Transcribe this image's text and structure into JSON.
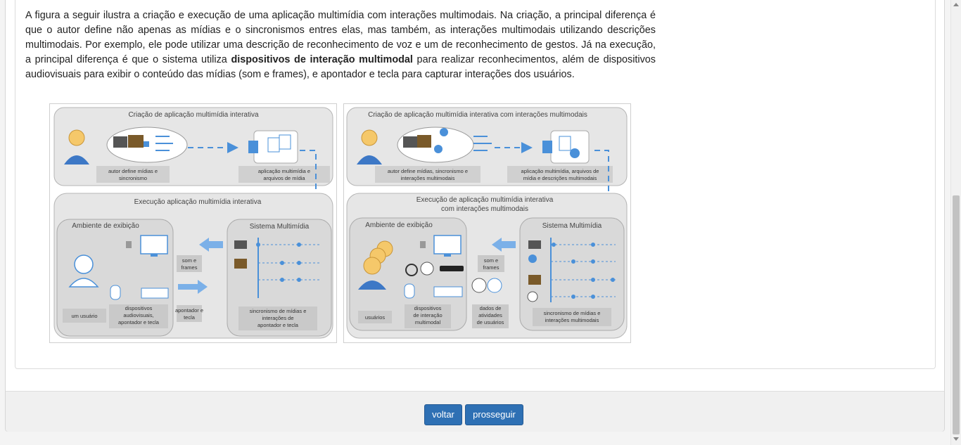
{
  "text": {
    "intro": "A figura a seguir ilustra a criação e execução de uma aplicação multimídia com interações multimodais. Na criação, a principal diferença é que o autor define não apenas as mídias e o sincronismos entres elas, mas também, as interações multimodais utilizando descrições multimodais. Por exemplo, ele pode utilizar uma descrição de reconhecimento de voz e um de reconhecimento de gestos. Já na execução, a principal diferença é que o sistema utiliza ",
    "highlight": "dispositivos de interação multimodal",
    "outro": " para realizar reconhecimentos, além de dispositivos audiovisuais para exibir o conteúdo das mídias (som e frames), e apontador e tecla para capturar interações dos usuários."
  },
  "figure_left": {
    "creation_title": "Criação de aplicação multimídia interativa",
    "author_caption_1": "autor define mídias e",
    "author_caption_2": "sincronismo",
    "app_caption_1": "aplicação multimídia e",
    "app_caption_2": "arquivos de mídia",
    "execution_title": "Execução aplicação multimídia interativa",
    "env_title": "Ambiente de exibição",
    "system_title": "Sistema Multimídia",
    "user_caption": "um usuário",
    "devices_caption_1": "dispositivos",
    "devices_caption_2": "audiovisuais,",
    "devices_caption_3": "apontador e tecla",
    "sound_caption_1": "som e",
    "sound_caption_2": "frames",
    "pointer_caption_1": "apontador e",
    "pointer_caption_2": "tecla",
    "sync_caption_1": "sincronismo de mídias e",
    "sync_caption_2": "interações de",
    "sync_caption_3": "apontador e tecla"
  },
  "figure_right": {
    "creation_title": "Criação de aplicação multimídia interativa com interações multimodais",
    "author_caption_1": "autor define mídias, sincronismo e",
    "author_caption_2": "interações multimodais",
    "app_caption_1": "aplicação multimídia, arquivos de",
    "app_caption_2": "mídia e descrições multimodais",
    "execution_title_1": "Execução de aplicação multimídia interativa",
    "execution_title_2": "com interações multimodais",
    "env_title": "Ambiente de exibição",
    "system_title": "Sistema Multimídia",
    "user_caption": "usuários",
    "devices_caption_1": "dispositivos",
    "devices_caption_2": "de interação",
    "devices_caption_3": "multimodal",
    "sound_caption_1": "som e",
    "sound_caption_2": "frames",
    "activity_caption_1": "dados de",
    "activity_caption_2": "atividades",
    "activity_caption_3": "de usuários",
    "sync_caption_1": "sincronismo de mídias e",
    "sync_caption_2": "interações multimodais"
  },
  "buttons": {
    "back": "voltar",
    "next": "prosseguir"
  },
  "colors": {
    "accent": "#2e70b4",
    "diagram_blue": "#4a90d9"
  }
}
